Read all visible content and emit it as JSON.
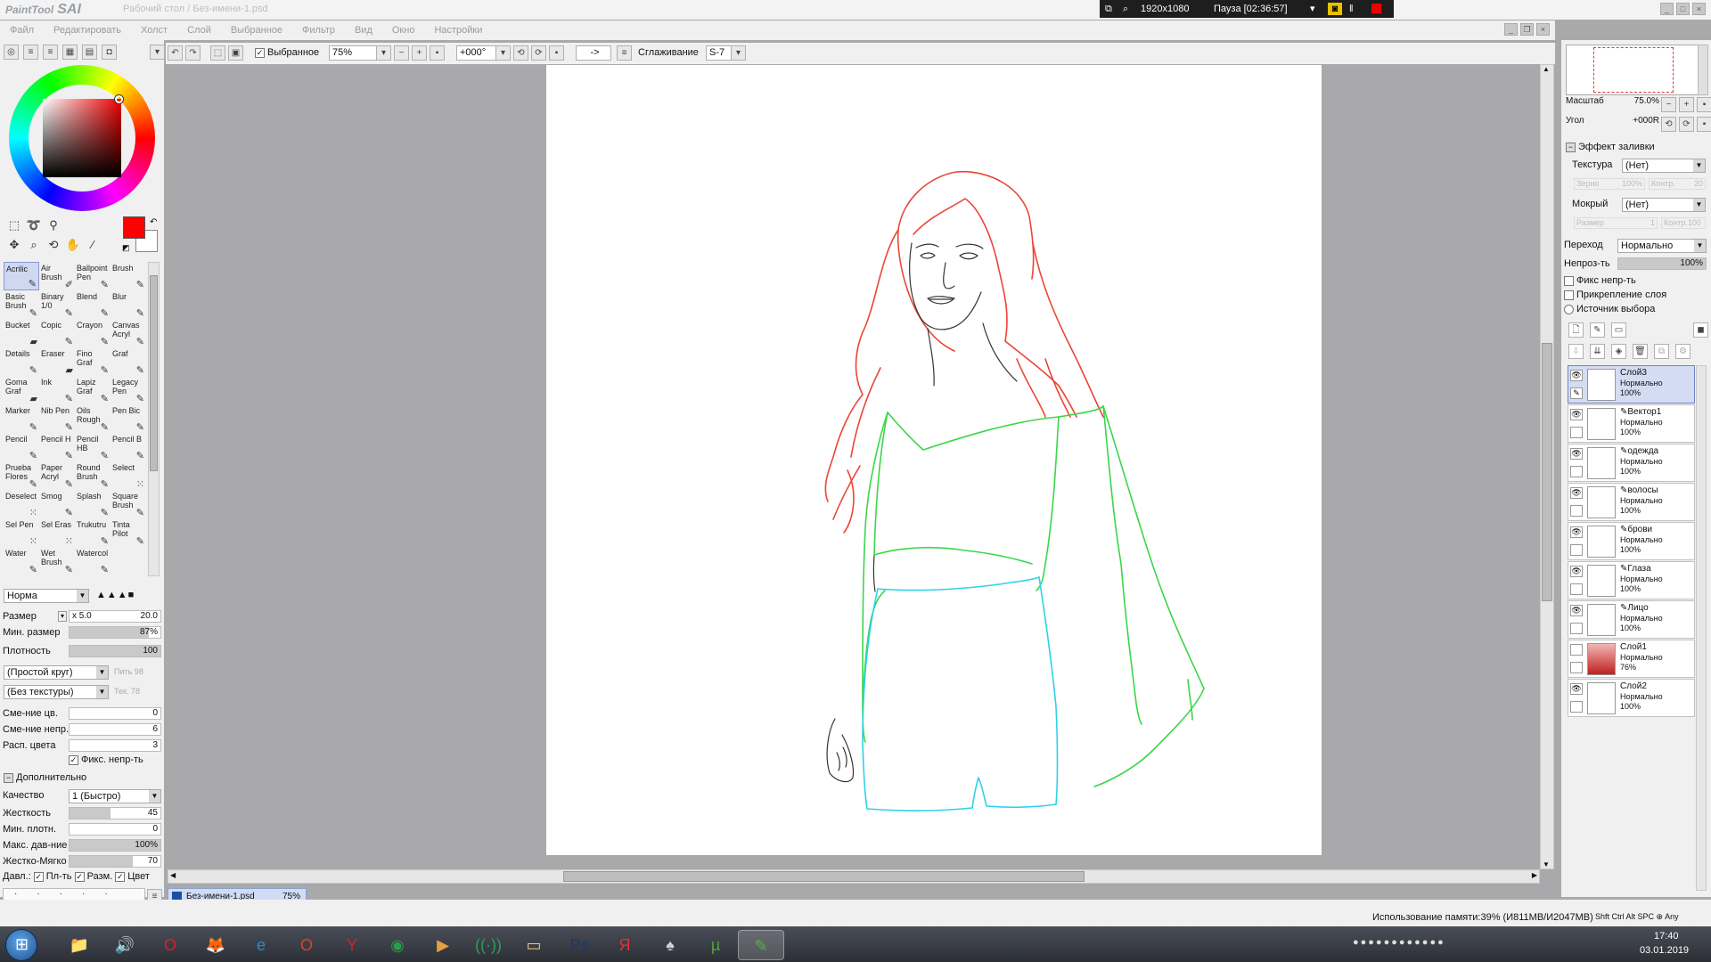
{
  "window": {
    "app_name": "PaintTool",
    "app_name_big": "SAI",
    "title": "Рабочий стол / Без-имени-1.psd",
    "recorder_resolution": "1920x1080",
    "recorder_status": "Пауза [02:36:57]"
  },
  "menu": [
    "Файл",
    "Редактировать",
    "Холст",
    "Слой",
    "Выбранное",
    "Фильтр",
    "Вид",
    "Окно",
    "Настройки"
  ],
  "toolbar": {
    "selection_label": "Выбранное",
    "zoom": "75%",
    "angle": "+000°",
    "arrow_btn": "->",
    "smoothing_label": "Сглаживание",
    "smoothing_value": "S-7"
  },
  "brushes": [
    {
      "name": "Acrilic",
      "icon": "✎"
    },
    {
      "name": "Air Brush",
      "icon": "✐"
    },
    {
      "name": "Ballpoint Pen",
      "icon": "✎"
    },
    {
      "name": "Brush",
      "icon": "✎"
    },
    {
      "name": "Basic Brush",
      "icon": "✎"
    },
    {
      "name": "Binary 1/0",
      "icon": "✎"
    },
    {
      "name": "Blend",
      "icon": "✎"
    },
    {
      "name": "Blur",
      "icon": "✎"
    },
    {
      "name": "Bucket",
      "icon": "▰"
    },
    {
      "name": "Copic",
      "icon": "✎"
    },
    {
      "name": "Crayon",
      "icon": "✎"
    },
    {
      "name": "Canvas Acryl",
      "icon": "✎"
    },
    {
      "name": "Details",
      "icon": "✎"
    },
    {
      "name": "Eraser",
      "icon": "▰"
    },
    {
      "name": "Fino Graf",
      "icon": "✎"
    },
    {
      "name": "Graf",
      "icon": "✎"
    },
    {
      "name": "Goma Graf",
      "icon": "▰"
    },
    {
      "name": "Ink",
      "icon": "✎"
    },
    {
      "name": "Lapiz Graf",
      "icon": "✎"
    },
    {
      "name": "Legacy Pen",
      "icon": "✎"
    },
    {
      "name": "Marker",
      "icon": "✎"
    },
    {
      "name": "Nib Pen",
      "icon": "✎"
    },
    {
      "name": "Oils Rough",
      "icon": "✎"
    },
    {
      "name": "Pen Bic",
      "icon": "✎"
    },
    {
      "name": "Pencil",
      "icon": "✎"
    },
    {
      "name": "Pencil H",
      "icon": "✎"
    },
    {
      "name": "Pencil HB",
      "icon": "✎"
    },
    {
      "name": "Pencil B",
      "icon": "✎"
    },
    {
      "name": "Prueba Flores",
      "icon": "✎"
    },
    {
      "name": "Paper Acryl",
      "icon": "✎"
    },
    {
      "name": "Round Brush",
      "icon": "✎"
    },
    {
      "name": "Select",
      "icon": "⁙"
    },
    {
      "name": "Deselect",
      "icon": "⁙"
    },
    {
      "name": "Smog",
      "icon": "✎"
    },
    {
      "name": "Splash",
      "icon": "✎"
    },
    {
      "name": "Square Brush",
      "icon": "✎"
    },
    {
      "name": "Sel Pen",
      "icon": "⁙"
    },
    {
      "name": "Sel Eras",
      "icon": "⁙"
    },
    {
      "name": "Trukutru",
      "icon": "✎"
    },
    {
      "name": "Tinta Pilot",
      "icon": "✎"
    },
    {
      "name": "Water",
      "icon": "✎"
    },
    {
      "name": "Wet Brush",
      "icon": "✎"
    },
    {
      "name": "Watercol",
      "icon": "✎"
    }
  ],
  "brush_settings": {
    "mode": "Норма",
    "size_label": "Размер",
    "size_mult": "x 5.0",
    "size_value": "20.0",
    "min_size_label": "Мин. размер",
    "min_size_value": "87%",
    "min_size_fraction": 0.87,
    "density_label": "Плотность",
    "density_value": "100",
    "density_fraction": 1.0,
    "shape": "(Простой круг)",
    "shape_strength": "Пить 98",
    "texture": "(Без текстуры)",
    "texture_strength": "Тек. 78",
    "blend_label": "Сме-ние цв.",
    "blend_value": "0",
    "dilution_label": "Сме-ние непр.",
    "dilution_value": "6",
    "persistence_label": "Расп. цвета",
    "persistence_value": "3",
    "keep_opacity_label": "Фикс. непр-ть",
    "advanced_label": "Дополнительно",
    "quality_label": "Качество",
    "quality_value": "1 (Быстро)",
    "hardness_label": "Жесткость",
    "hardness_value": "45",
    "hardness_fraction": 0.45,
    "min_density_label": "Мин. плотн.",
    "min_density_value": "0",
    "max_pressure_label": "Макс. дав-ние",
    "max_pressure_value": "100%",
    "hard_soft_label": "Жестко-Мягко",
    "hard_soft_value": "70",
    "hard_soft_fraction": 0.7,
    "pressure_label": "Давл.:",
    "pressure_opts": [
      "Пл-ть",
      "Разм.",
      "Цвет"
    ]
  },
  "navigator": {
    "scale_label": "Масштаб",
    "scale_value": "75.0%",
    "angle_label": "Угол",
    "angle_value": "+000R"
  },
  "layer_props": {
    "fill_effect_label": "Эффект заливки",
    "texture_label": "Текстура",
    "texture_value": "(Нет)",
    "grain_label": "Зерно",
    "grain_value": "100%",
    "contrast_label": "Контр.",
    "contrast_value": "20",
    "wet_label": "Мокрый",
    "wet_value": "(Нет)",
    "wet_size_label": "Размер",
    "wet_size_value": "1",
    "wet_contrast_label": "Контр.",
    "wet_contrast_value": "100",
    "blend_mode_label": "Переход",
    "blend_mode_value": "Нормально",
    "opacity_label": "Непроз-ть",
    "opacity_value": "100%",
    "opacity_fraction": 1.0,
    "fix_opacity_label": "Фикс непр-ть",
    "clip_label": "Прикрепление слоя",
    "sel_source_label": "Источник выбора"
  },
  "layers": [
    {
      "name": "Слой3",
      "mode": "Нормально",
      "opacity": "100%",
      "vector": false,
      "selected": true,
      "visible": true
    },
    {
      "name": "Вектор1",
      "mode": "Нормально",
      "opacity": "100%",
      "vector": true,
      "selected": false,
      "visible": true
    },
    {
      "name": "одежда",
      "mode": "Нормально",
      "opacity": "100%",
      "vector": true,
      "selected": false,
      "visible": true
    },
    {
      "name": "волосы",
      "mode": "Нормально",
      "opacity": "100%",
      "vector": true,
      "selected": false,
      "visible": true
    },
    {
      "name": "брови",
      "mode": "Нормально",
      "opacity": "100%",
      "vector": true,
      "selected": false,
      "visible": true
    },
    {
      "name": "Глаза",
      "mode": "Нормально",
      "opacity": "100%",
      "vector": true,
      "selected": false,
      "visible": true
    },
    {
      "name": "Лицо",
      "mode": "Нормально",
      "opacity": "100%",
      "vector": true,
      "selected": false,
      "visible": true
    },
    {
      "name": "Слой1",
      "mode": "Нормально",
      "opacity": "76%",
      "vector": false,
      "selected": false,
      "visible": false
    },
    {
      "name": "Слой2",
      "mode": "Нормально",
      "opacity": "100%",
      "vector": false,
      "selected": false,
      "visible": true
    }
  ],
  "document_tab": {
    "name": "Без-имени-1.psd",
    "zoom": "75%"
  },
  "status": {
    "memory": "Использование памяти:39% (И811MB/И2047MB)",
    "keys": "Shft Ctrl Alt SPC ⊕ Any"
  },
  "taskbar": {
    "time": "17:40",
    "date": "03.01.2019",
    "apps": [
      {
        "name": "explorer",
        "icon": "📁",
        "color": "#e8c35a"
      },
      {
        "name": "audio",
        "icon": "🔊",
        "color": "#6aa0d8"
      },
      {
        "name": "opera",
        "icon": "O",
        "color": "#d8202a"
      },
      {
        "name": "firefox",
        "icon": "🦊",
        "color": "#e86a1a"
      },
      {
        "name": "ie",
        "icon": "e",
        "color": "#2a8ad8"
      },
      {
        "name": "opera2",
        "icon": "O",
        "color": "#e0402a"
      },
      {
        "name": "yandex-browser",
        "icon": "Y",
        "color": "#d8202a"
      },
      {
        "name": "chrome",
        "icon": "◉",
        "color": "#2e9c4a"
      },
      {
        "name": "media",
        "icon": "▶",
        "color": "#e8a040"
      },
      {
        "name": "network",
        "icon": "((·))",
        "color": "#2aa050"
      },
      {
        "name": "folder",
        "icon": "▭",
        "color": "#e8d080"
      },
      {
        "name": "photoshop",
        "icon": "Ps",
        "color": "#1a3a6a"
      },
      {
        "name": "yandex",
        "icon": "Я",
        "color": "#e83030"
      },
      {
        "name": "cards",
        "icon": "♠",
        "color": "#d0d0d0"
      },
      {
        "name": "utorrent",
        "icon": "µ",
        "color": "#4aa83a"
      },
      {
        "name": "sai",
        "icon": "✎",
        "color": "#5ab04a"
      }
    ]
  }
}
